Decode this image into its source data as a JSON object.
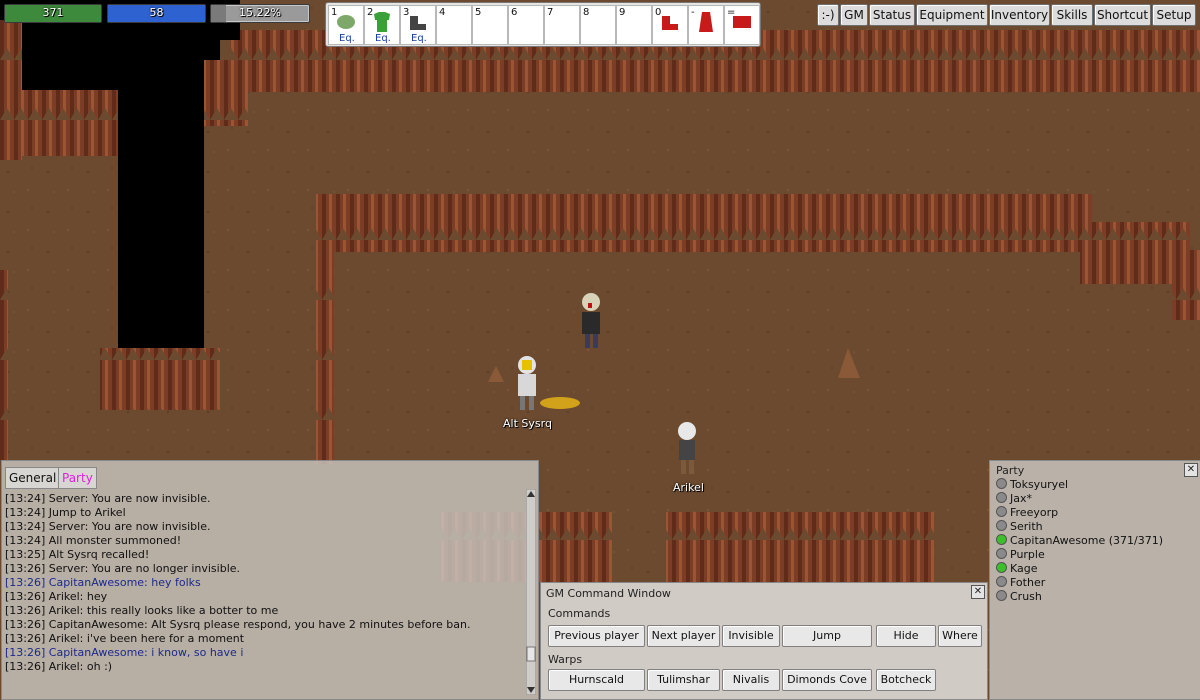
{
  "hud": {
    "hp": {
      "value": "371",
      "fraction": 1.0,
      "color": "#3d8a3d"
    },
    "mp": {
      "value": "58",
      "fraction": 1.0,
      "color": "#2e62d0"
    },
    "xp": {
      "value": "15.22%",
      "fraction": 0.1522,
      "color": "#7a7a7a"
    }
  },
  "shortcuts": [
    {
      "num": "1",
      "eq": "Eq.",
      "icon": "bandana-icon",
      "color": "#7ea86a"
    },
    {
      "num": "2",
      "eq": "Eq.",
      "icon": "shirt-icon",
      "color": "#3aa03a"
    },
    {
      "num": "3",
      "eq": "Eq.",
      "icon": "boots-icon",
      "color": "#444444"
    },
    {
      "num": "4",
      "eq": "",
      "icon": "",
      "color": ""
    },
    {
      "num": "5",
      "eq": "",
      "icon": "",
      "color": ""
    },
    {
      "num": "6",
      "eq": "",
      "icon": "",
      "color": ""
    },
    {
      "num": "7",
      "eq": "",
      "icon": "",
      "color": ""
    },
    {
      "num": "8",
      "eq": "",
      "icon": "",
      "color": ""
    },
    {
      "num": "9",
      "eq": "",
      "icon": "",
      "color": ""
    },
    {
      "num": "0",
      "eq": "",
      "icon": "red-shoes-icon",
      "color": "#c81a1a"
    },
    {
      "num": "-",
      "eq": "",
      "icon": "red-robe-icon",
      "color": "#c81a1a"
    },
    {
      "num": "=",
      "eq": "",
      "icon": "gm-cap-icon",
      "color": "#c81a1a"
    }
  ],
  "menu": [
    ":-)",
    "GM",
    "Status",
    "Equipment",
    "Inventory",
    "Skills",
    "Shortcut",
    "Setup"
  ],
  "characters": [
    {
      "label": "Alt Sysrq"
    },
    {
      "label": "Arikel"
    },
    {
      "label": ""
    }
  ],
  "chat": {
    "tabs": [
      {
        "label": "General",
        "color": "#111111"
      },
      {
        "label": "Party",
        "color": "#e020e0"
      }
    ],
    "lines": [
      {
        "text": "[13:24] Server: You are now invisible.",
        "style": "normal"
      },
      {
        "text": "[13:24] Jump to Arikel",
        "style": "normal"
      },
      {
        "text": "[13:24] Server: You are now invisible.",
        "style": "normal"
      },
      {
        "text": "[13:24] All monster summoned!",
        "style": "normal"
      },
      {
        "text": "[13:25] Alt Sysrq recalled!",
        "style": "normal"
      },
      {
        "text": "[13:26] Server: You are no longer invisible.",
        "style": "normal"
      },
      {
        "text": "[13:26] CapitanAwesome: hey folks",
        "style": "blue"
      },
      {
        "text": "[13:26] Arikel: hey",
        "style": "normal"
      },
      {
        "text": "[13:26] Arikel: this really looks like a botter to me",
        "style": "normal"
      },
      {
        "text": "[13:26] CapitanAwesome: Alt Sysrq please respond, you have 2 minutes before ban.",
        "style": "normal"
      },
      {
        "text": "[13:26] Arikel: i've been here for a moment",
        "style": "normal"
      },
      {
        "text": "[13:26] CapitanAwesome: i know, so have i",
        "style": "blue"
      },
      {
        "text": "[13:26] Arikel: oh :)",
        "style": "normal"
      }
    ]
  },
  "party": {
    "title": "Party",
    "members": [
      {
        "name": "Toksyuryel",
        "online": false
      },
      {
        "name": "Jax*",
        "online": false
      },
      {
        "name": "Freeyorp",
        "online": false
      },
      {
        "name": "Serith",
        "online": false
      },
      {
        "name": "CapitanAwesome  (371/371)",
        "online": true
      },
      {
        "name": "Purple",
        "online": false
      },
      {
        "name": "Kage",
        "online": true
      },
      {
        "name": "Fother",
        "online": false
      },
      {
        "name": "Crush",
        "online": false
      }
    ]
  },
  "gm": {
    "title": "GM Command Window",
    "commands_label": "Commands",
    "warps_label": "Warps",
    "commands": [
      "Previous player",
      "Next player",
      "Invisible",
      "Jump",
      "Hide",
      "Where"
    ],
    "warps": [
      "Hurnscald",
      "Tulimshar",
      "Nivalis",
      "Dimonds Cove",
      "Botcheck"
    ]
  },
  "colors": {
    "cave_floor": "#6b4a2f",
    "cliff": "#7e3f26",
    "void": "#000000",
    "online": "#3bbf2b",
    "offline": "#8a8a8a"
  }
}
